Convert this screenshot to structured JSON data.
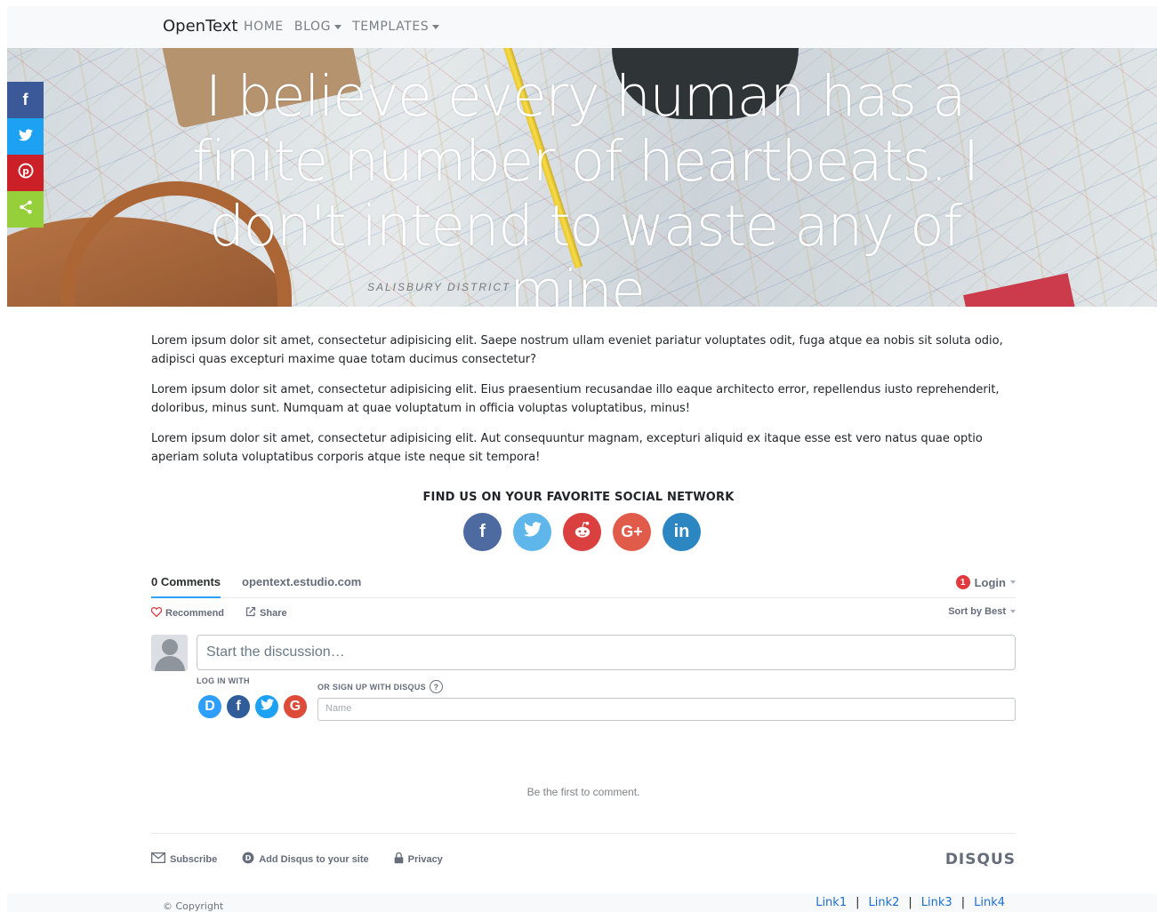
{
  "navbar": {
    "brand": "OpenText",
    "items": [
      {
        "label": "HOME",
        "dropdown": false
      },
      {
        "label": "BLOG",
        "dropdown": true
      },
      {
        "label": "TEMPLATES",
        "dropdown": true
      }
    ]
  },
  "hero": {
    "quote": "I believe every human has a finite number of heartbeats. I don't intend to waste any of mine.",
    "map_label": "SALISBURY  DISTRICT"
  },
  "share_sidebar": [
    {
      "icon": "facebook-icon",
      "glyph": "f",
      "color": "#3b5998"
    },
    {
      "icon": "twitter-icon",
      "glyph": "🐦",
      "color": "#1da1f2"
    },
    {
      "icon": "pinterest-icon",
      "glyph": "P",
      "color": "#cb2027"
    },
    {
      "icon": "share-icon",
      "glyph": "⋖",
      "color": "#95d03a"
    }
  ],
  "content": {
    "paragraphs": [
      "Lorem ipsum dolor sit amet, consectetur adipisicing elit. Saepe nostrum ullam eveniet pariatur voluptates odit, fuga atque ea nobis sit soluta odio, adipisci quas excepturi maxime quae totam ducimus consectetur?",
      "Lorem ipsum dolor sit amet, consectetur adipisicing elit. Eius praesentium recusandae illo eaque architecto error, repellendus iusto reprehenderit, doloribus, minus sunt. Numquam at quae voluptatum in officia voluptas voluptatibus, minus!",
      "Lorem ipsum dolor sit amet, consectetur adipisicing elit. Aut consequuntur magnam, excepturi aliquid ex itaque esse est vero natus quae optio aperiam soluta voluptatibus corporis atque iste neque sit tempora!"
    ]
  },
  "social": {
    "title": "FIND US ON YOUR FAVORITE SOCIAL NETWORK",
    "networks": [
      {
        "icon": "facebook-icon",
        "glyph": "f",
        "color": "#4d6aa1"
      },
      {
        "icon": "twitter-icon",
        "glyph": "🐦",
        "color": "#5eb6ea"
      },
      {
        "icon": "reddit-icon",
        "glyph": "☻",
        "color": "#d9403f"
      },
      {
        "icon": "google-plus-icon",
        "glyph": "G+",
        "color": "#e15b4a"
      },
      {
        "icon": "linkedin-icon",
        "glyph": "in",
        "color": "#2b86c1"
      }
    ]
  },
  "disqus": {
    "comments_tab": "0 Comments",
    "site_tab": "opentext.estudio.com",
    "notification_count": "1",
    "login_label": "Login",
    "recommend_label": "Recommend",
    "share_label": "Share",
    "sort_label": "Sort by Best",
    "comment_placeholder": "Start the discussion…",
    "login_with_label": "LOG IN WITH",
    "signup_label": "OR SIGN UP WITH DISQUS",
    "help_glyph": "?",
    "providers": [
      {
        "icon": "disqus-icon",
        "glyph": "D",
        "color": "#2e9fff"
      },
      {
        "icon": "facebook-icon",
        "glyph": "f",
        "color": "#305c99"
      },
      {
        "icon": "twitter-icon",
        "glyph": "🐦",
        "color": "#1da1f2"
      },
      {
        "icon": "google-icon",
        "glyph": "G",
        "color": "#dd4b39"
      }
    ],
    "name_placeholder": "Name",
    "empty_message": "Be the first to comment.",
    "footer": {
      "subscribe_label": "Subscribe",
      "add_disqus_label": "Add Disqus to your site",
      "privacy_label": "Privacy",
      "logo": "DISQUS"
    }
  },
  "page_footer": {
    "copyright": "© Copyright",
    "links": [
      "Link1",
      "Link2",
      "Link3",
      "Link4"
    ],
    "separator": "|"
  }
}
